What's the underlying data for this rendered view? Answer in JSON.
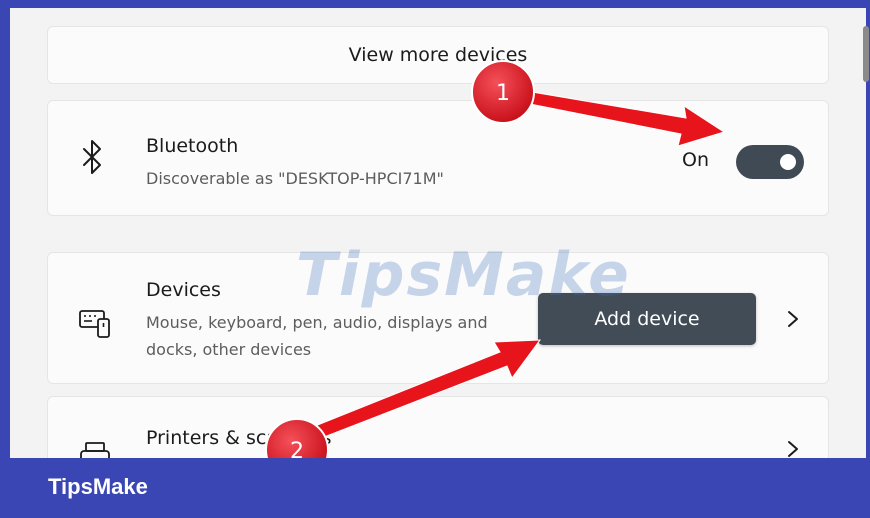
{
  "view_more": {
    "label": "View more devices"
  },
  "bluetooth": {
    "icon": "bluetooth-icon",
    "title": "Bluetooth",
    "description": "Discoverable as \"DESKTOP-HPCI71M\"",
    "toggle_label": "On",
    "toggle_on": true
  },
  "devices": {
    "icon": "keyboard-device-icon",
    "title": "Devices",
    "description": "Mouse, keyboard, pen, audio, displays and docks, other devices",
    "button_label": "Add device"
  },
  "printers": {
    "icon": "printer-icon",
    "title": "Printers & scanners"
  },
  "annotations": [
    {
      "number": "1"
    },
    {
      "number": "2"
    }
  ],
  "watermark": "TipsMake",
  "footer": {
    "brand": "TipsMake"
  },
  "colors": {
    "frame": "#3a46b4",
    "toggle_on": "#3f4a54",
    "button_bg": "#414c56",
    "annotation_red": "#e8141c"
  }
}
